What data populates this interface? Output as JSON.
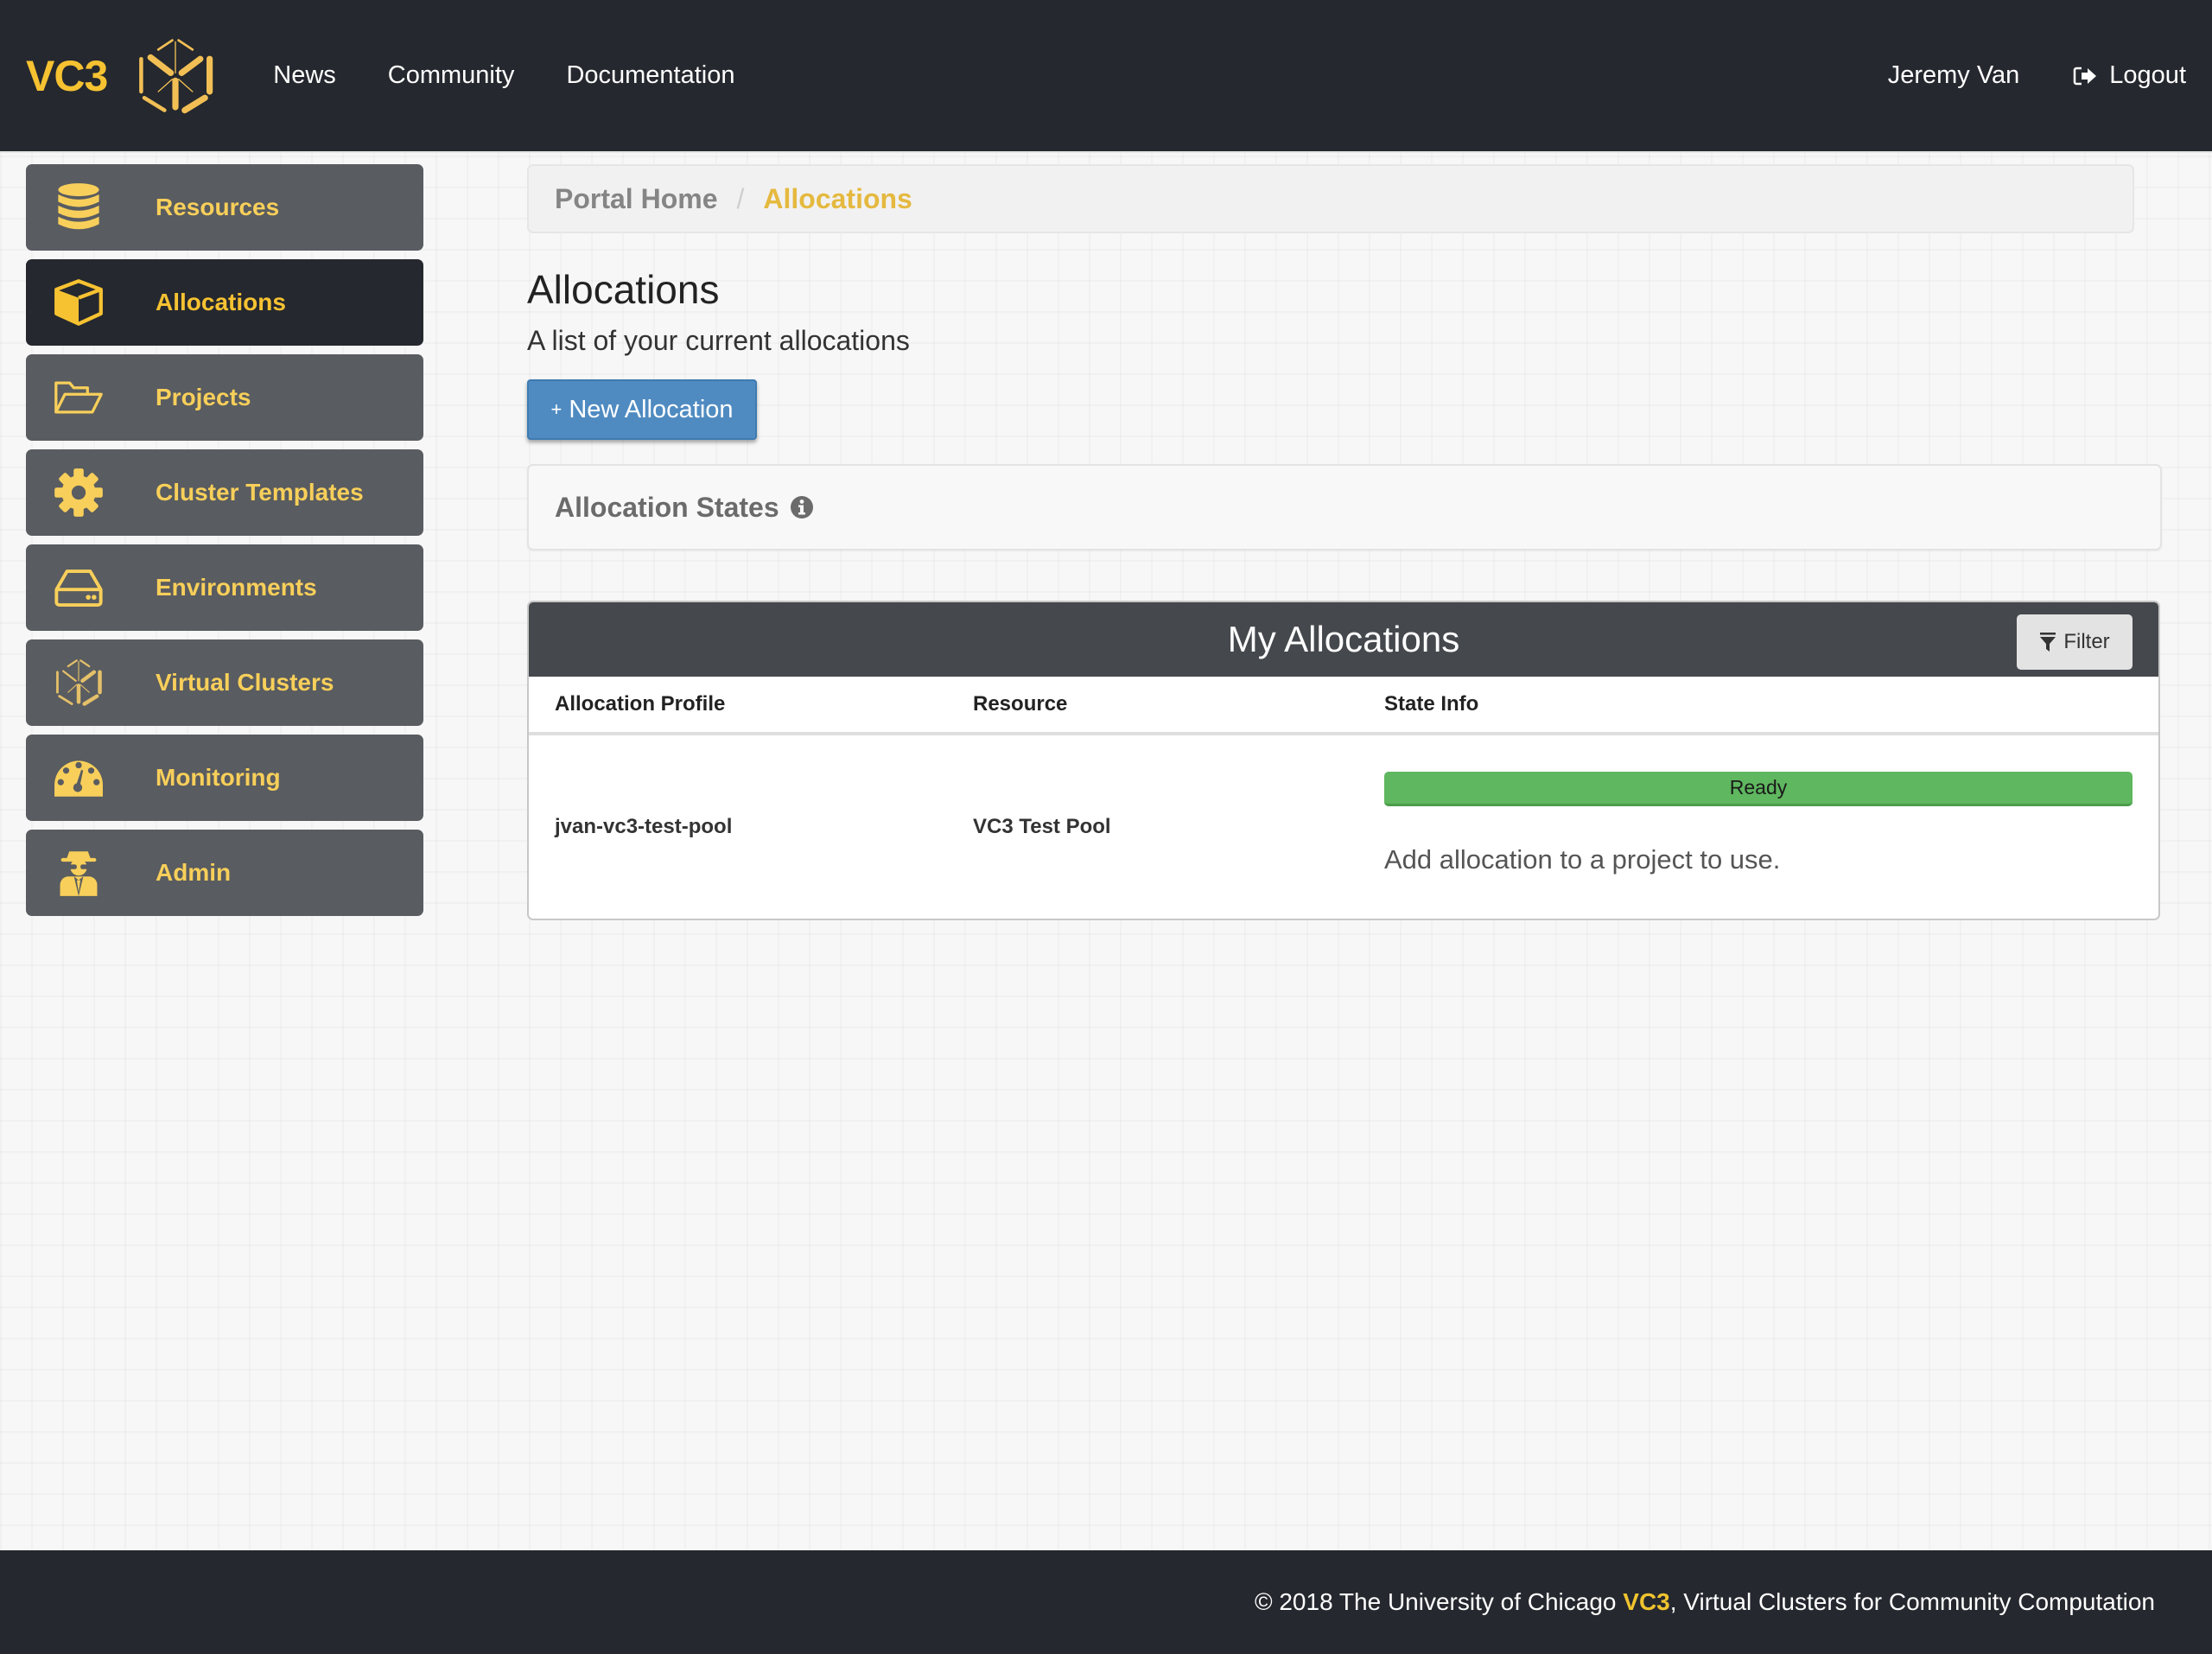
{
  "navbar": {
    "brand": "VC3",
    "links": [
      "News",
      "Community",
      "Documentation"
    ],
    "user": "Jeremy Van",
    "logout_label": "Logout"
  },
  "sidebar": {
    "items": [
      {
        "label": "Resources",
        "icon": "database-icon",
        "active": false
      },
      {
        "label": "Allocations",
        "icon": "cube-icon",
        "active": true
      },
      {
        "label": "Projects",
        "icon": "folder-open-icon",
        "active": false
      },
      {
        "label": "Cluster Templates",
        "icon": "gear-icon",
        "active": false
      },
      {
        "label": "Environments",
        "icon": "hard-drive-icon",
        "active": false
      },
      {
        "label": "Virtual Clusters",
        "icon": "vc3-logo-icon",
        "active": false
      },
      {
        "label": "Monitoring",
        "icon": "dashboard-gauge-icon",
        "active": false
      },
      {
        "label": "Admin",
        "icon": "user-secret-icon",
        "active": false
      }
    ]
  },
  "breadcrumb": {
    "home": "Portal Home",
    "separator": "/",
    "current": "Allocations"
  },
  "page": {
    "title": "Allocations",
    "subtitle": "A list of your current allocations",
    "new_button_plus": "+",
    "new_button_label": "New Allocation",
    "states_title": "Allocation States"
  },
  "allocations_table": {
    "title": "My Allocations",
    "filter_label": "Filter",
    "columns": [
      "Allocation Profile",
      "Resource",
      "State Info"
    ],
    "rows": [
      {
        "profile": "jvan-vc3-test-pool",
        "resource": "VC3 Test Pool",
        "state": "Ready",
        "state_color": "#5fb75f",
        "note": "Add allocation to a project to use."
      }
    ]
  },
  "footer": {
    "prefix": "© 2018 The University of Chicago ",
    "brand": "VC3",
    "suffix": ", Virtual Clusters for Community Computation"
  },
  "colors": {
    "navbar_bg": "#25282e",
    "accent_yellow": "#f6c231",
    "sidebar_item_bg": "#595c60",
    "primary_button": "#4f8bc1",
    "ready_green": "#5fb75f"
  }
}
